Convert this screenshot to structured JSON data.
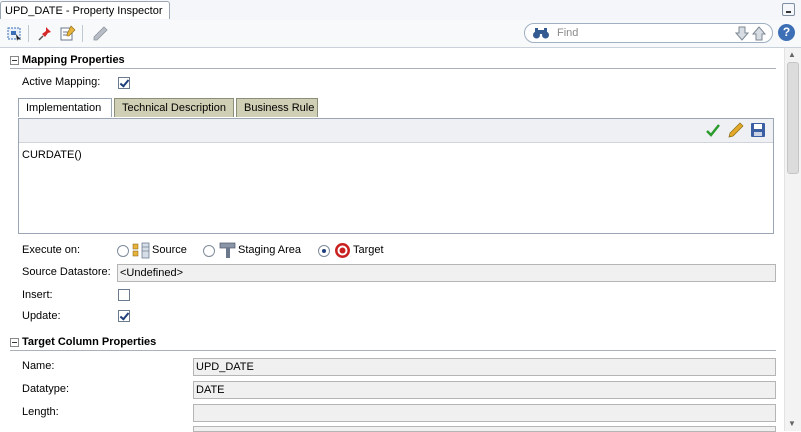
{
  "window": {
    "title": "UPD_DATE - Property Inspector"
  },
  "toolbar": {
    "icons": [
      "select-icon",
      "pin-icon",
      "edit-properties-icon",
      "pencil-icon"
    ],
    "find_placeholder": "Find",
    "help_label": "?"
  },
  "mapping": {
    "section_title": "Mapping Properties",
    "active_mapping_label": "Active Mapping:",
    "active_mapping_checked": true,
    "tabs": [
      {
        "label": "Implementation",
        "active": true
      },
      {
        "label": "Technical Description",
        "active": false
      },
      {
        "label": "Business Rule",
        "active": false
      }
    ],
    "expression": "CURDATE()",
    "execute_on_label": "Execute on:",
    "execute_options": [
      {
        "label": "Source",
        "selected": false
      },
      {
        "label": "Staging Area",
        "selected": false
      },
      {
        "label": "Target",
        "selected": true
      }
    ],
    "source_datastore_label": "Source Datastore:",
    "source_datastore_value": "<Undefined>",
    "insert_label": "Insert:",
    "insert_checked": false,
    "update_label": "Update:",
    "update_checked": true
  },
  "target": {
    "section_title": "Target Column Properties",
    "name_label": "Name:",
    "name_value": "UPD_DATE",
    "datatype_label": "Datatype:",
    "datatype_value": "DATE",
    "length_label": "Length:",
    "length_value": ""
  },
  "colors": {
    "accent": "#3d6fb6",
    "tab_inactive": "#cfcfb5",
    "check_green": "#2e9b2e"
  }
}
